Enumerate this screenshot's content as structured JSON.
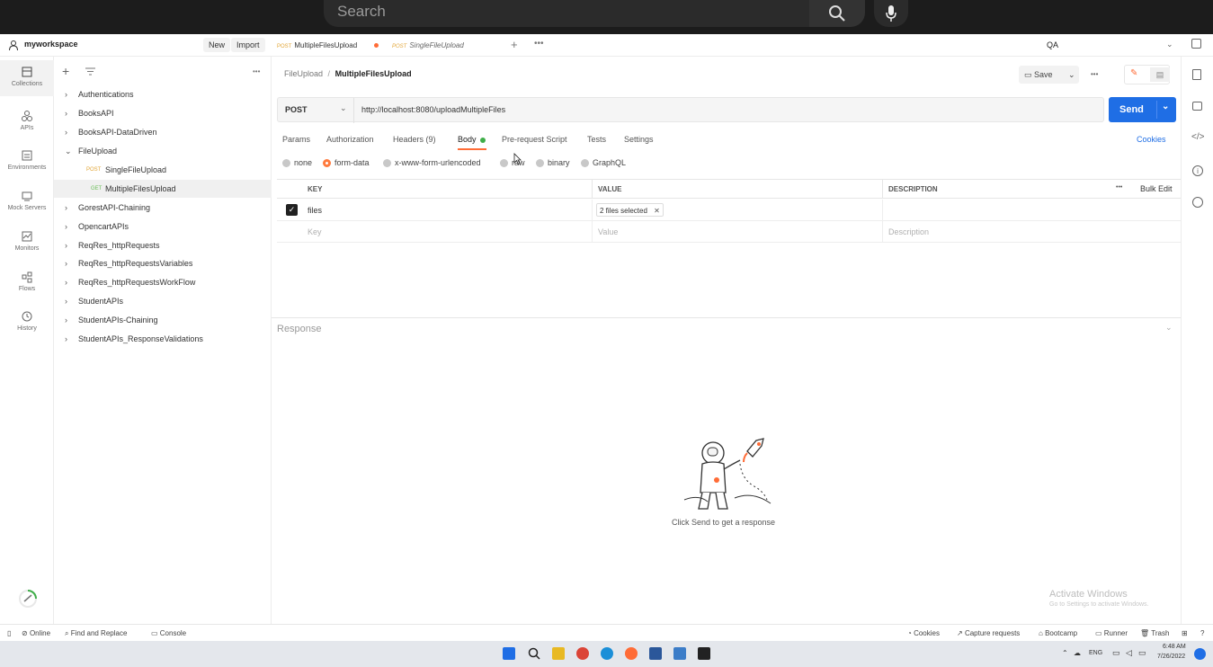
{
  "overlay": {
    "search_placeholder": "Search"
  },
  "header": {
    "workspace": "myworkspace",
    "new_label": "New",
    "import_label": "Import",
    "tabs": [
      {
        "method": "POST",
        "name": "MultipleFilesUpload"
      },
      {
        "method": "POST",
        "name": "SingleFileUpload"
      }
    ],
    "environment": "QA"
  },
  "rail": [
    {
      "label": "Collections",
      "icon": "collections-icon"
    },
    {
      "label": "APIs",
      "icon": "apis-icon"
    },
    {
      "label": "Environments",
      "icon": "environments-icon"
    },
    {
      "label": "Mock Servers",
      "icon": "mock-servers-icon"
    },
    {
      "label": "Monitors",
      "icon": "monitors-icon"
    },
    {
      "label": "Flows",
      "icon": "flows-icon"
    },
    {
      "label": "History",
      "icon": "history-icon"
    }
  ],
  "tree": [
    "Authentications",
    "BooksAPI",
    "BooksAPI-DataDriven",
    "FileUpload",
    {
      "method": "POST",
      "name": "SingleFileUpload"
    },
    {
      "method": "GET",
      "name": "MultipleFilesUpload"
    },
    "GorestAPI-Chaining",
    "OpencartAPIs",
    "ReqRes_httpRequests",
    "ReqRes_httpRequestsVariables",
    "ReqRes_httpRequestsWorkFlow",
    "StudentAPIs",
    "StudentAPIs-Chaining",
    "StudentAPIs_ResponseValidations"
  ],
  "breadcrumb": {
    "parent": "FileUpload",
    "sep": "/",
    "current": "MultipleFilesUpload"
  },
  "save_label": "Save",
  "request": {
    "method": "POST",
    "url": "http://localhost:8080/uploadMultipleFiles",
    "send_label": "Send"
  },
  "req_tabs": [
    "Params",
    "Authorization",
    "Headers (9)",
    "Body",
    "Pre-request Script",
    "Tests",
    "Settings"
  ],
  "cookies_label": "Cookies",
  "body_modes": [
    "none",
    "form-data",
    "x-www-form-urlencoded",
    "raw",
    "binary",
    "GraphQL"
  ],
  "body_selected": "form-data",
  "table": {
    "headers": {
      "key": "KEY",
      "value": "VALUE",
      "description": "DESCRIPTION",
      "bulk": "Bulk Edit"
    },
    "row": {
      "key": "files",
      "value": "2 files selected"
    },
    "placeholder": {
      "key": "Key",
      "value": "Value",
      "description": "Description"
    }
  },
  "response": {
    "title": "Response",
    "hint": "Click Send to get a response"
  },
  "watermark": {
    "line1": "Activate Windows",
    "line2": "Go to Settings to activate Windows."
  },
  "status": {
    "online": "Online",
    "find": "Find and Replace",
    "console": "Console",
    "cookies": "Cookies",
    "capture": "Capture requests",
    "bootcamp": "Bootcamp",
    "runner": "Runner",
    "trash": "Trash"
  },
  "taskbar": {
    "lang": "ENG",
    "time": "6:48 AM",
    "date": "7/26/2022"
  },
  "colors": {
    "accent": "#ff6c37",
    "send": "#1f6ee5",
    "post": "#e2a638",
    "get": "#6bbf59"
  }
}
